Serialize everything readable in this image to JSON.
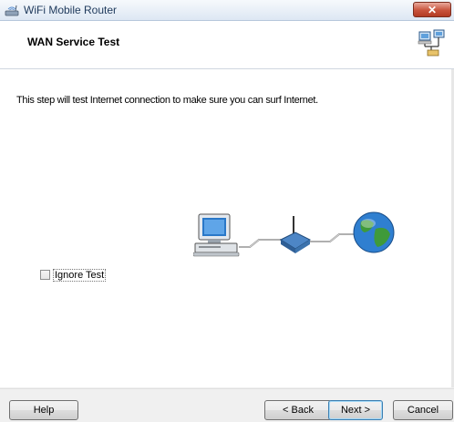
{
  "window": {
    "title": "WiFi Mobile Router",
    "close_label": "✕"
  },
  "header": {
    "title": "WAN Service Test",
    "icon": "network-wizard-icon"
  },
  "content": {
    "description": "This step will test Internet connection to make sure you can surf Internet.",
    "diagram_icons": [
      "computer-icon",
      "router-icon",
      "globe-icon"
    ],
    "ignore_test": {
      "label": "Ignore Test",
      "checked": false
    }
  },
  "footer": {
    "help_label": "Help",
    "back_label": "< Back",
    "next_label": "Next >",
    "cancel_label": "Cancel"
  }
}
